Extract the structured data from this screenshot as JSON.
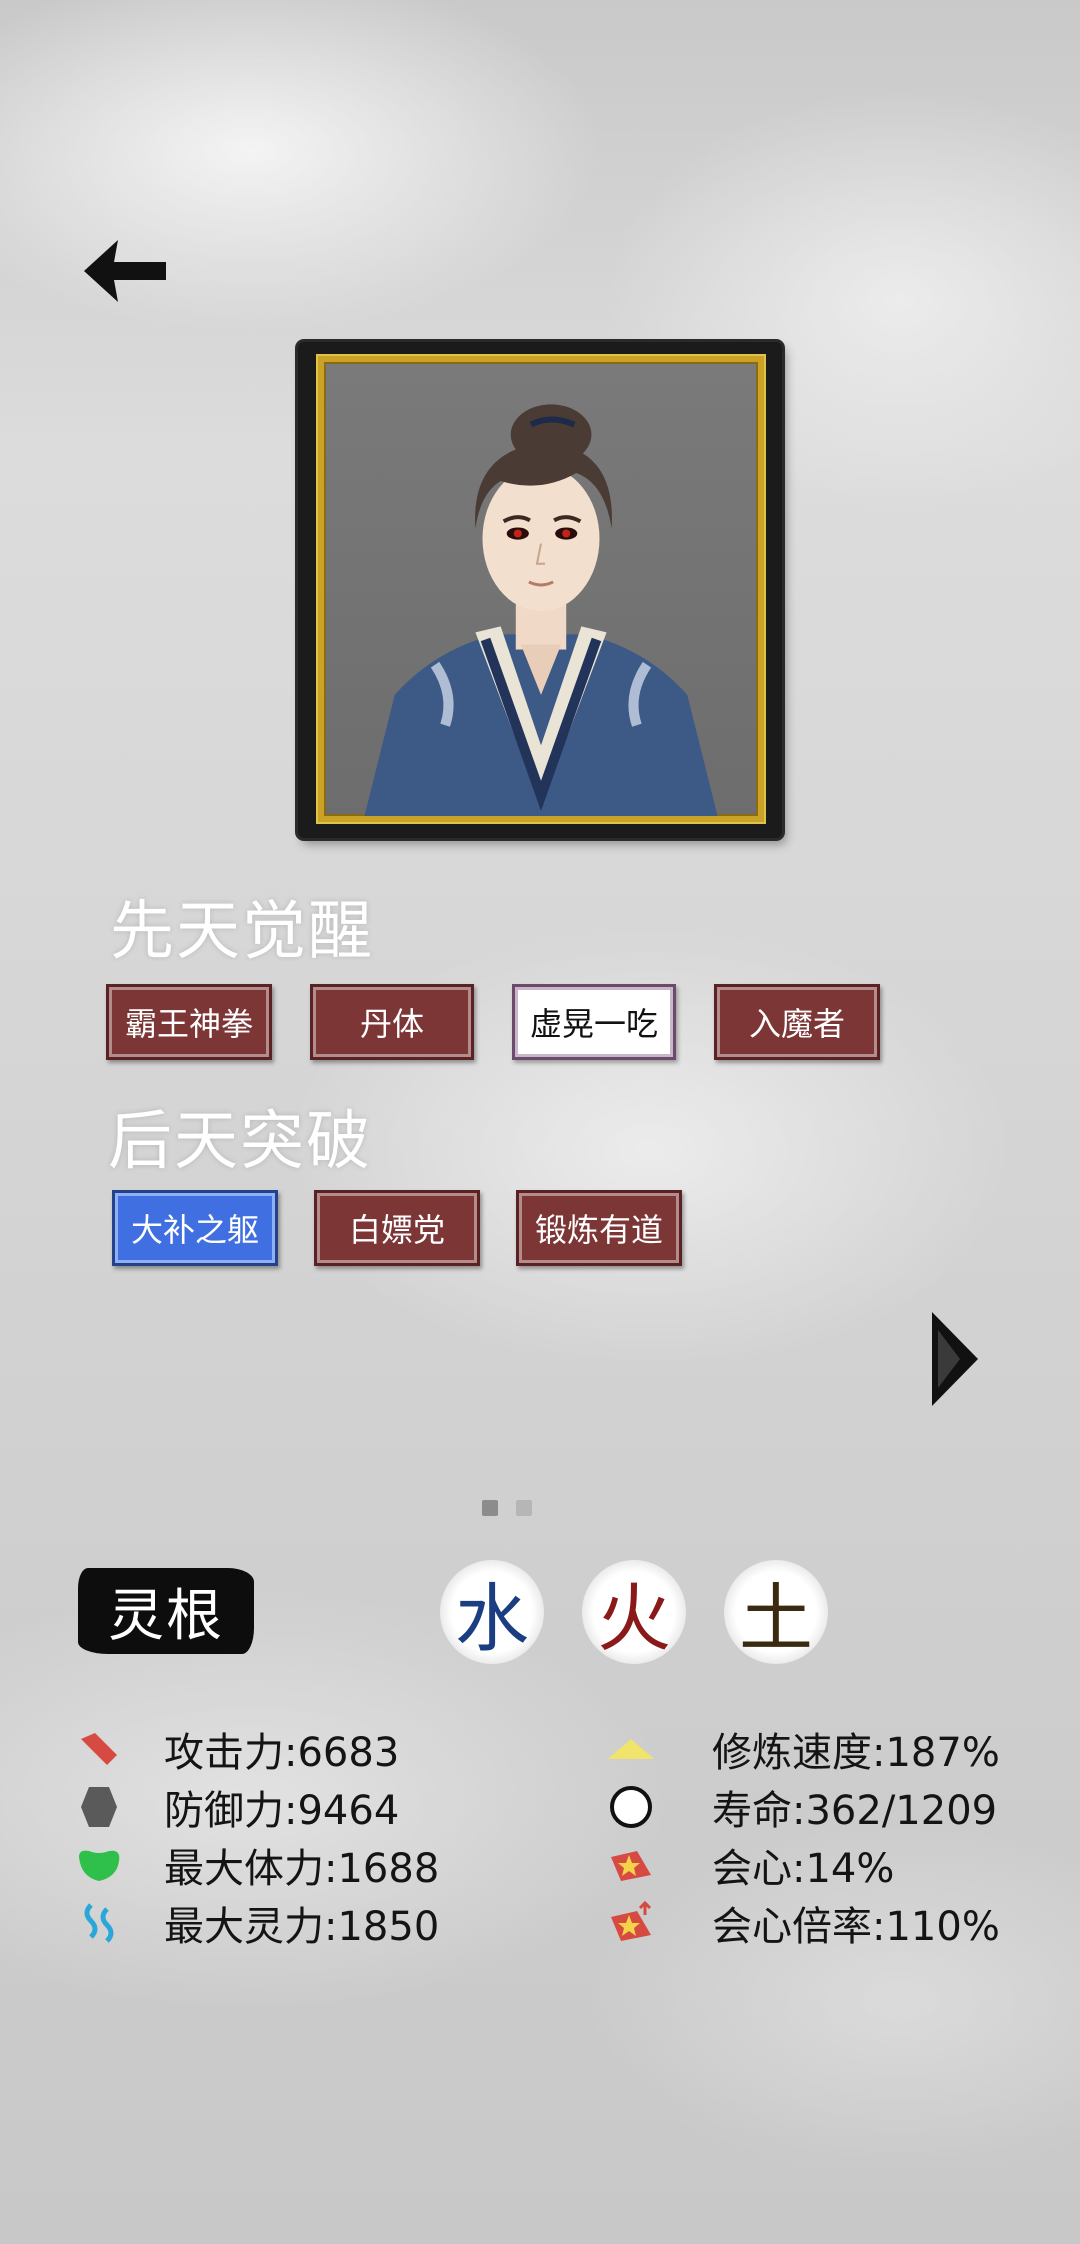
{
  "header": {
    "back_icon": "arrow-left-icon"
  },
  "sections": {
    "innate_title": "先天觉醒",
    "acquired_title": "后天突破"
  },
  "innate_talents": [
    "霸王神拳",
    "丹体",
    "虚晃一吃",
    "入魔者"
  ],
  "acquired_talents": [
    "大补之躯",
    "白嫖党",
    "锻炼有道"
  ],
  "pager": {
    "next_icon": "triangle-right-icon",
    "page_count": 2,
    "current_page": 1
  },
  "linggen": {
    "label": "灵根",
    "elements": [
      "水",
      "火",
      "土"
    ],
    "colors": {
      "water": "#1b3e82",
      "fire": "#8a1a1a",
      "earth": "#3a2a10"
    }
  },
  "stats_left": [
    {
      "icon": "sword-icon",
      "text": "攻击力:6683"
    },
    {
      "icon": "shield-icon",
      "text": "防御力:9464"
    },
    {
      "icon": "heart-icon",
      "text": "最大体力:1688"
    },
    {
      "icon": "spirit-wave-icon",
      "text": "最大灵力:1850"
    }
  ],
  "stats_right": [
    {
      "icon": "triangle-up-icon",
      "text": "修炼速度:187%"
    },
    {
      "icon": "ring-icon",
      "text": "寿命:362/1209"
    },
    {
      "icon": "critical-icon",
      "text": "会心:14%"
    },
    {
      "icon": "critical-rate-icon",
      "text": "会心倍率:110%"
    }
  ],
  "colors": {
    "talent_red": "#7c3636",
    "talent_white": "#ffffff",
    "talent_blue": "#3f6fe0"
  }
}
